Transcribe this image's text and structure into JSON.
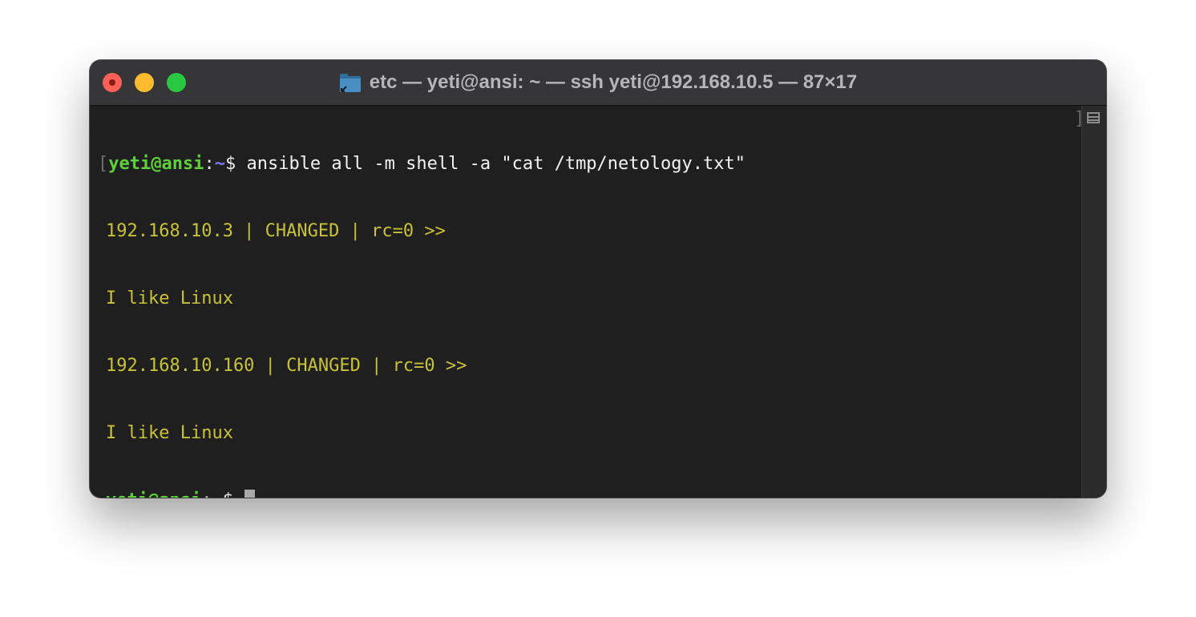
{
  "window": {
    "title": "etc — yeti@ansi: ~ — ssh yeti@192.168.10.5 — 87×17",
    "title_icon": "folder-icon",
    "traffic_lights": [
      "close",
      "minimize",
      "maximize"
    ],
    "colors": {
      "close": "#fe5f57",
      "minimize": "#febc2e",
      "maximize": "#28c840"
    }
  },
  "terminal": {
    "bracket_left": "[",
    "bracket_right": "]",
    "prompt_user": "yeti@ansi",
    "prompt_sep": ":",
    "prompt_path": "~",
    "prompt_symbol": "$",
    "command": " ansible all -m shell -a \"cat /tmp/netology.txt\"",
    "output": [
      "192.168.10.3 | CHANGED | rc=0 >>",
      "I like Linux",
      "192.168.10.160 | CHANGED | rc=0 >>",
      "I like Linux"
    ],
    "colors": {
      "user": "#5fd03c",
      "path": "#7d78ff",
      "output": "#c8c13a",
      "background": "#1f1f1f"
    }
  },
  "scrollbar": {
    "icon": "split-pane-icon"
  }
}
